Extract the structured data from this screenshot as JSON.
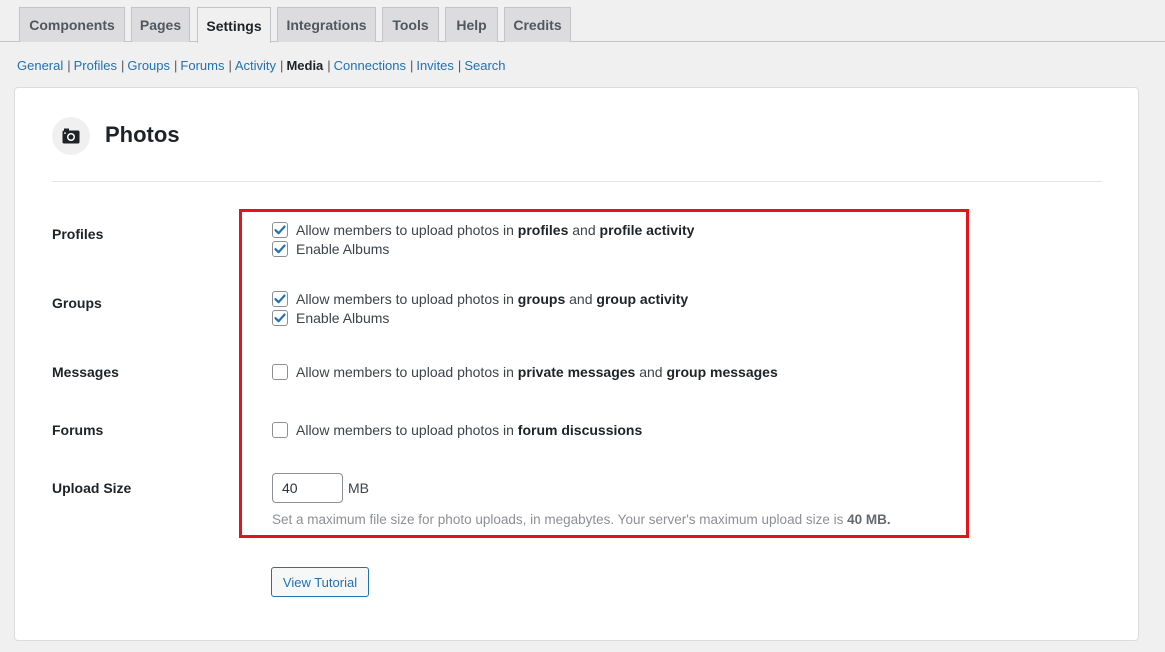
{
  "tabs": [
    "Components",
    "Pages",
    "Settings",
    "Integrations",
    "Tools",
    "Help",
    "Credits"
  ],
  "active_tab": "Settings",
  "subnav": {
    "items": [
      "General",
      "Profiles",
      "Groups",
      "Forums",
      "Activity",
      "Media",
      "Connections",
      "Invites",
      "Search"
    ],
    "current": "Media"
  },
  "section": {
    "title": "Photos",
    "icon": "camera-icon"
  },
  "rows": {
    "profiles": {
      "label": "Profiles",
      "opt1": {
        "pre": "Allow members to upload photos in ",
        "b1": "profiles",
        "mid": " and ",
        "b2": "profile activity",
        "checked": true
      },
      "opt2": {
        "text": "Enable Albums",
        "checked": true
      }
    },
    "groups": {
      "label": "Groups",
      "opt1": {
        "pre": "Allow members to upload photos in ",
        "b1": "groups",
        "mid": " and ",
        "b2": "group activity",
        "checked": true
      },
      "opt2": {
        "text": "Enable Albums",
        "checked": true
      }
    },
    "messages": {
      "label": "Messages",
      "opt1": {
        "pre": "Allow members to upload photos in ",
        "b1": "private messages",
        "mid": " and ",
        "b2": "group messages",
        "checked": false
      }
    },
    "forums": {
      "label": "Forums",
      "opt1": {
        "pre": "Allow members to upload photos in ",
        "b1": "forum discussions",
        "checked": false
      }
    },
    "upload": {
      "label": "Upload Size",
      "value": "40",
      "unit": "MB",
      "hint_pre": "Set a maximum file size for photo uploads, in megabytes. Your server's maximum upload size is ",
      "hint_b": "40 MB."
    }
  },
  "tutorial_button": "View Tutorial",
  "colors": {
    "accent": "#2271b1",
    "highlight_box": "#e3141b",
    "checkbox_checked": "#2271b1"
  }
}
